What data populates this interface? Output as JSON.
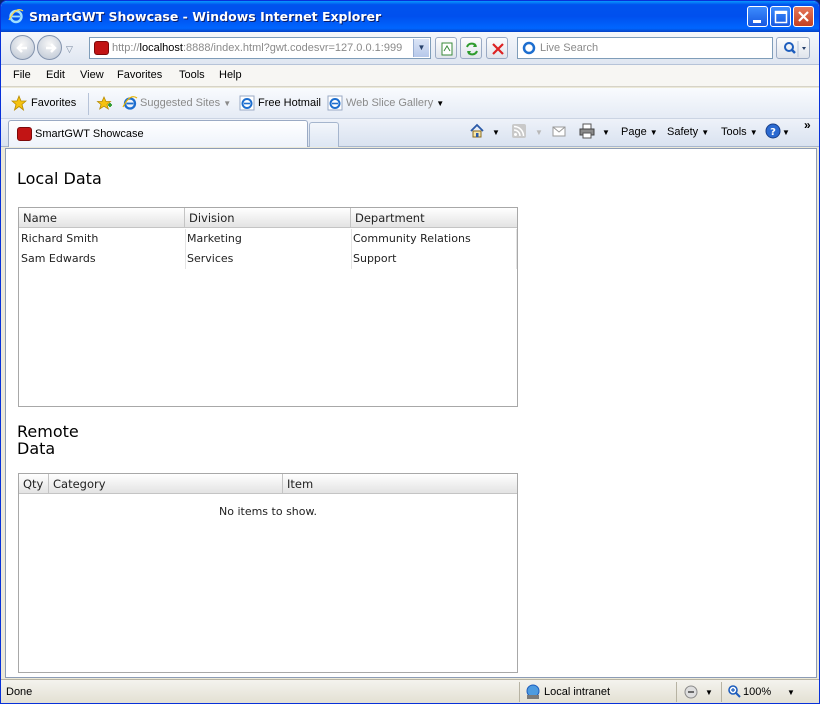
{
  "window": {
    "title": "SmartGWT Showcase - Windows Internet Explorer"
  },
  "address_bar": {
    "url_prefix": "http://",
    "url_host": "localhost",
    "url_rest": ":8888/index.html?gwt.codesvr=127.0.0.1:999",
    "search_placeholder": "Live Search"
  },
  "menu": [
    "File",
    "Edit",
    "View",
    "Favorites",
    "Tools",
    "Help"
  ],
  "favorites_bar": {
    "favorites_label": "Favorites",
    "suggested_sites": "Suggested Sites",
    "free_hotmail": "Free Hotmail",
    "web_slice_gallery": "Web Slice Gallery"
  },
  "tabs": {
    "active_label": "SmartGWT Showcase"
  },
  "command_bar": {
    "page": "Page",
    "safety": "Safety",
    "tools": "Tools"
  },
  "page": {
    "local_section": {
      "title": "Local Data",
      "columns": [
        "Name",
        "Division",
        "Department"
      ],
      "rows": [
        [
          "Richard Smith",
          "Marketing",
          "Community Relations"
        ],
        [
          "Sam Edwards",
          "Services",
          "Support"
        ]
      ]
    },
    "remote_section": {
      "title_line1": "Remote",
      "title_line2": "Data",
      "columns": [
        "Qty",
        "Category",
        "Item"
      ],
      "empty_message": "No items to show."
    }
  },
  "status_bar": {
    "status": "Done",
    "zone": "Local intranet",
    "zoom": "100%"
  }
}
